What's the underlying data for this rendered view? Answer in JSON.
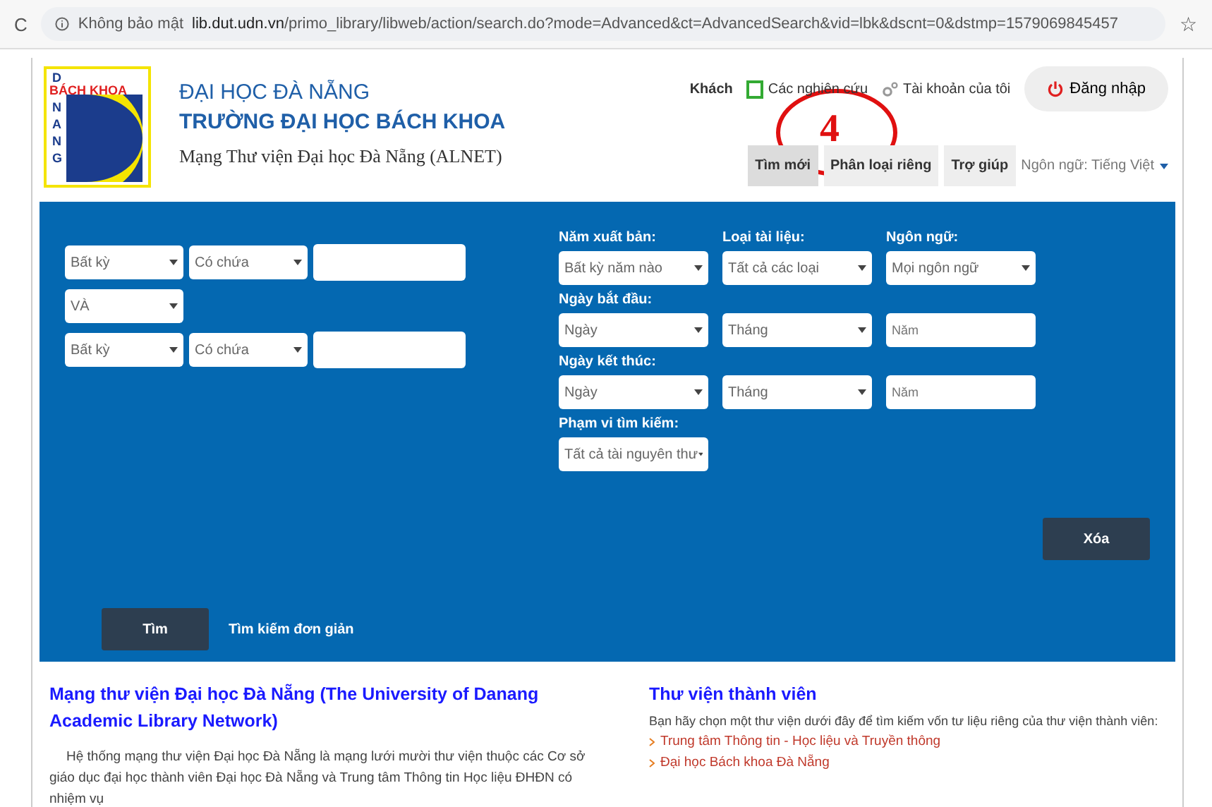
{
  "browser": {
    "reload": "C",
    "security": "Không bảo mật",
    "url_host": "lib.dut.udn.vn",
    "url_path": "/primo_library/libweb/action/search.do?mode=Advanced&ct=AdvancedSearch&vid=lbk&dscnt=0&dstmp=1579069845457",
    "star": "☆"
  },
  "logo": {
    "top": "D",
    "band": "BÁCH KHOA",
    "side": [
      "N",
      "A",
      "N",
      "G"
    ]
  },
  "header": {
    "line1": "ĐẠI HỌC ĐÀ NẴNG",
    "line2": "TRƯỜNG ĐẠI HỌC BÁCH KHOA",
    "line3": "Mạng Thư viện Đại học Đà Nẵng (ALNET)"
  },
  "user_bar": {
    "guest": "Khách",
    "research": "Các nghiên cứu",
    "account": "Tài khoản của tôi",
    "login": "Đăng nhập"
  },
  "nav": [
    {
      "label": "Tìm mới",
      "selected": true
    },
    {
      "label": "Phân loại riêng",
      "selected": false
    },
    {
      "label": "Trợ giúp",
      "selected": false
    }
  ],
  "language": "Ngôn ngữ: Tiếng Việt",
  "annotation": {
    "number": "4"
  },
  "query_rows": [
    {
      "kind": "query",
      "field": "Bất kỳ",
      "match": "Có chứa"
    },
    {
      "kind": "operator",
      "field": "VÀ"
    },
    {
      "kind": "query",
      "field": "Bất kỳ",
      "match": "Có chứa"
    }
  ],
  "filters": [
    {
      "label": "Năm xuất bản:",
      "label2": "Loại tài liệu:",
      "label3": "Ngôn ngữ:",
      "controls": [
        {
          "kind": "select",
          "value": "Bất kỳ năm nào"
        },
        {
          "kind": "select",
          "value": "Tất cả các loại"
        },
        {
          "kind": "select",
          "value": "Mọi ngôn ngữ"
        }
      ]
    },
    {
      "label": "Ngày bắt đầu:",
      "controls": [
        {
          "kind": "select",
          "value": "Ngày"
        },
        {
          "kind": "select",
          "value": "Tháng"
        },
        {
          "kind": "input",
          "placeholder": "Năm"
        }
      ]
    },
    {
      "label": "Ngày kết thúc:",
      "controls": [
        {
          "kind": "select",
          "value": "Ngày"
        },
        {
          "kind": "select",
          "value": "Tháng"
        },
        {
          "kind": "input",
          "placeholder": "Năm"
        }
      ]
    },
    {
      "label": "Phạm vi tìm kiếm:",
      "controls": [
        {
          "kind": "select",
          "value": "Tất cả tài nguyên thư"
        }
      ]
    }
  ],
  "clear_button": "Xóa",
  "search_button": "Tìm",
  "simple_search": "Tìm kiếm đơn giản",
  "about": {
    "title": "Mạng thư viện Đại học Đà Nẵng (The University of Danang Academic Library Network)",
    "text": "Hệ thống mạng thư viện Đại học Đà Nẵng là mạng lưới mười thư viện thuộc các Cơ sở giáo dục đại học thành viên Đại học Đà Nẵng và Trung tâm Thông tin Học liệu ĐHĐN có nhiệm vụ"
  },
  "members": {
    "title": "Thư viện thành viên",
    "intro": "Bạn hãy chọn một thư viện dưới đây để tìm kiếm vốn tư liệu riêng của thư viện thành viên:",
    "links": [
      "Trung tâm Thông tin - Học liệu và Truyền thông",
      "Đại học Bách khoa Đà Nẵng"
    ]
  }
}
